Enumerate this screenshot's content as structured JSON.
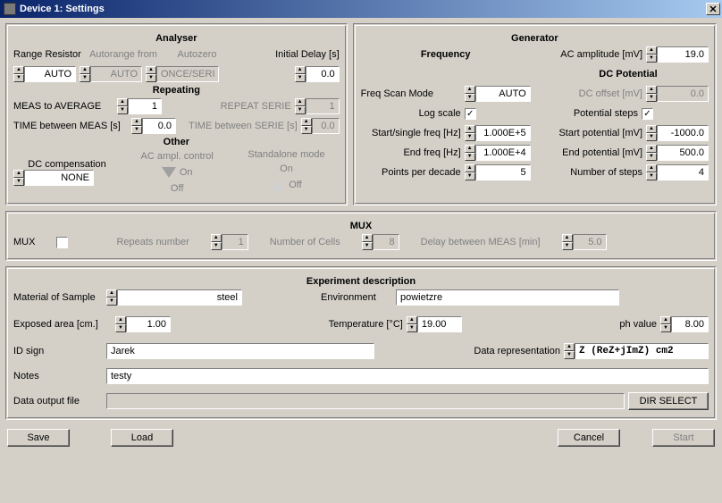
{
  "window": {
    "title": "Device 1: Settings"
  },
  "analyser": {
    "title": "Analyser",
    "range_resistor_label": "Range Resistor",
    "range_resistor_value": "AUTO",
    "autorange_from_label": "Autorange from",
    "autorange_from_value": "AUTO",
    "autozero_label": "Autozero",
    "autozero_value": "ONCE/SERIE",
    "initial_delay_label": "Initial Delay [s]",
    "initial_delay_value": "0.0"
  },
  "repeating": {
    "title": "Repeating",
    "meas_avg_label": "MEAS to AVERAGE",
    "meas_avg_value": "1",
    "repeat_serie_label": "REPEAT SERIE",
    "repeat_serie_value": "1",
    "time_between_meas_label": "TIME between MEAS [s]",
    "time_between_meas_value": "0.0",
    "time_between_serie_label": "TIME between SERIE [s]",
    "time_between_serie_value": "0.0"
  },
  "other": {
    "title": "Other",
    "dc_comp_label": "DC compensation",
    "dc_comp_value": "NONE",
    "ac_ampl_control_label": "AC ampl. control",
    "standalone_label": "Standalone mode",
    "on_label": "On",
    "off_label": "Off"
  },
  "generator": {
    "title": "Generator",
    "frequency_heading": "Frequency",
    "ac_amplitude_label": "AC amplitude [mV]",
    "ac_amplitude_value": "19.0",
    "dc_potential_heading": "DC Potential",
    "freq_scan_mode_label": "Freq Scan Mode",
    "freq_scan_mode_value": "AUTO",
    "dc_offset_label": "DC offset [mV]",
    "dc_offset_value": "0.0",
    "log_scale_label": "Log scale",
    "log_scale_checked": true,
    "potential_steps_label": "Potential steps",
    "potential_steps_checked": true,
    "start_freq_label": "Start/single freq [Hz]",
    "start_freq_value": "1.000E+5",
    "start_potential_label": "Start potential [mV]",
    "start_potential_value": "-1000.0",
    "end_freq_label": "End freq [Hz]",
    "end_freq_value": "1.000E+4",
    "end_potential_label": "End potential [mV]",
    "end_potential_value": "500.0",
    "points_per_decade_label": "Points per decade",
    "points_per_decade_value": "5",
    "number_of_steps_label": "Number of steps",
    "number_of_steps_value": "4"
  },
  "mux": {
    "title": "MUX",
    "mux_label": "MUX",
    "mux_checked": false,
    "repeats_label": "Repeats number",
    "repeats_value": "1",
    "num_cells_label": "Number of Cells",
    "num_cells_value": "8",
    "delay_label": "Delay between MEAS [min]",
    "delay_value": "5.0"
  },
  "experiment": {
    "title": "Experiment description",
    "material_label": "Material of Sample",
    "material_value": "steel",
    "environment_label": "Environment",
    "environment_value": "powietzre",
    "exposed_area_label": "Exposed area [cm.]",
    "exposed_area_value": "1.00",
    "temperature_label": "Temperature [°C]",
    "temperature_value": "19.00",
    "ph_label": "ph value",
    "ph_value": "8.00",
    "id_sign_label": "ID sign",
    "id_sign_value": "Jarek",
    "data_repr_label": "Data representation",
    "data_repr_value": "Z (ReZ+jImZ) cm2",
    "notes_label": "Notes",
    "notes_value": "testy",
    "output_file_label": "Data output file",
    "output_file_value": "",
    "dir_select_label": "DIR SELECT"
  },
  "buttons": {
    "save": "Save",
    "load": "Load",
    "cancel": "Cancel",
    "start": "Start"
  }
}
